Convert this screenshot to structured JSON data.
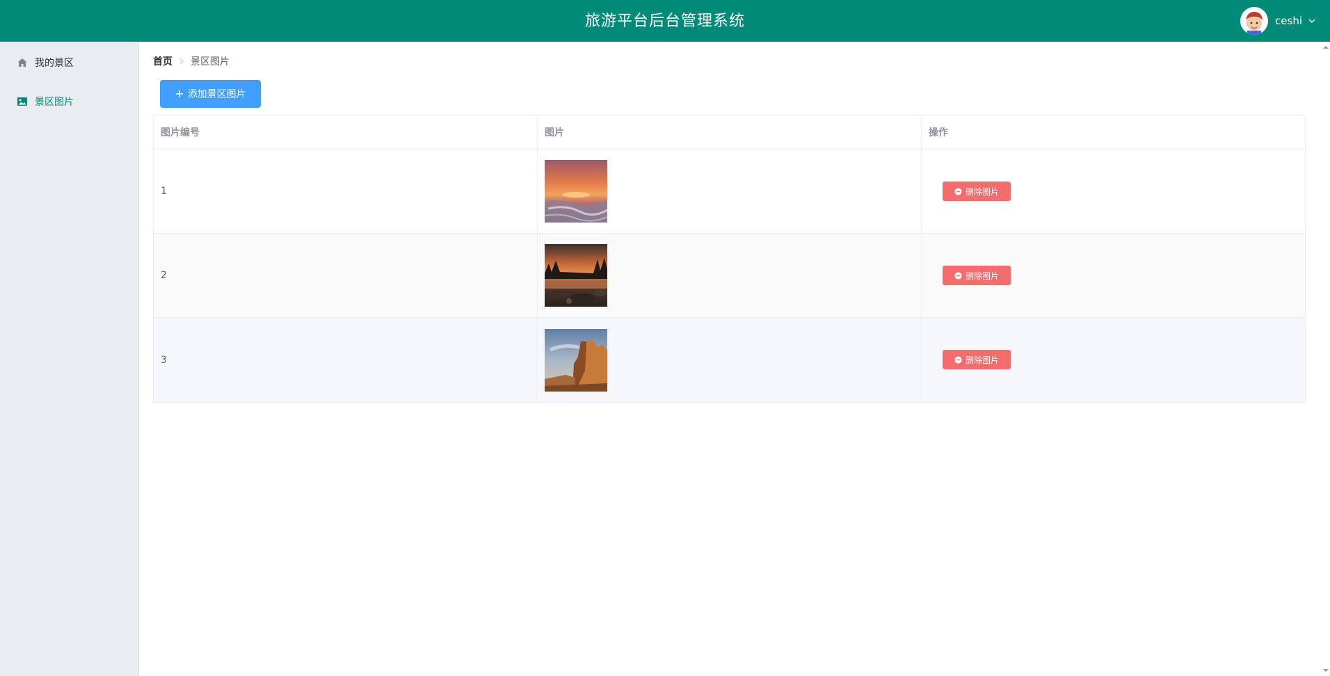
{
  "header": {
    "title": "旅游平台后台管理系统",
    "username": "ceshi"
  },
  "sidebar": {
    "items": [
      {
        "label": "我的景区",
        "icon": "home-icon",
        "active": false
      },
      {
        "label": "景区图片",
        "icon": "picture-icon",
        "active": true
      }
    ]
  },
  "breadcrumb": {
    "home": "首页",
    "current": "景区图片"
  },
  "toolbar": {
    "add_label": "添加景区图片"
  },
  "table": {
    "columns": [
      "图片编号",
      "图片",
      "操作"
    ],
    "rows": [
      {
        "id": "1",
        "image": "sunset-sea-photo",
        "action": "删除图片"
      },
      {
        "id": "2",
        "image": "river-dusk-photo",
        "action": "删除图片"
      },
      {
        "id": "3",
        "image": "desert-cliff-photo",
        "action": "删除图片"
      }
    ]
  },
  "colors": {
    "header": "#008b78",
    "sidebar": "#e9edf1",
    "primary": "#409eff",
    "danger": "#f56c6c",
    "active_menu": "#008b78"
  }
}
